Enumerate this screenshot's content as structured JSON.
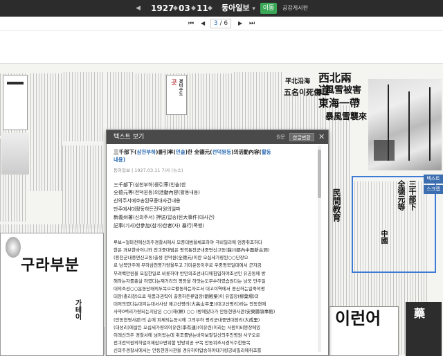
{
  "toolbar": {
    "prev_year": "◀",
    "year": "1927",
    "year_arrow": "◆",
    "month": "03",
    "month_arrow": "◆",
    "day": "11",
    "day_arrow": "◆",
    "publication": "동아일보",
    "publication_arrow": "▾",
    "go_label": "이동",
    "board_label": "공감게시판"
  },
  "pager": {
    "first": "⏮",
    "prev": "◀",
    "current": "3",
    "separator": " / ",
    "total": "6",
    "next": "▶",
    "last": "⏭"
  },
  "side_tabs": [
    "텍스트",
    "스크랩"
  ],
  "modal": {
    "title": "텍스트 보기",
    "tab_original": "원문",
    "tab_hangul": "한글변환",
    "close": "✕",
    "headline_parts": [
      {
        "text": "三千部下(",
        "h": false
      },
      {
        "text": "삼천부하",
        "h": true
      },
      {
        "text": ")를引率(",
        "h": false
      },
      {
        "text": "인솔",
        "h": true
      },
      {
        "text": ")한 全德元(",
        "h": false
      },
      {
        "text": "전덕원등",
        "h": true
      },
      {
        "text": ")의活動內容(",
        "h": false
      },
      {
        "text": "활동",
        "h": true
      }
    ],
    "headline_line2": "내용)",
    "meta": "동아일보 | 1927.03.11 기사 (뉴스)",
    "sublines": [
      "三千部下(삼천부하)를引率(인솔)한",
      "全德元等(전덕원등)의活動內容(활동내용)",
      "신의주서에호송된모중대사건내용",
      "만주에서대활동하든전덕원의일파",
      "新義州署(신의주서) 押送(압송)된大事件(대사건)",
      "記事(기사)한參加(참가)한者(자) 暴行(폭행)"
    ],
    "paragraph": [
      "루보=얼마전에신의주경찰서에서 모중대범을체포하야 극비밀리에 엄중취조하다",
      "한은 과보한바어니와 전긔중대범은 평북통천군내중면신고동(龍川郡內中面新古洞)",
      "(용천군내중면신고동)출생 전덕원(全德元)이란 오십세가량된○○단장으",
      "로 남북만주에 부하삼천명가량을두고 기미운동이후로 우중평북일대에서 군자금",
      "무려백만원을 모집한일로 비롯하야 반민의조선내디에침입하야조선인 유공동에 방",
      "해하는자를총살 하였다는재거리의 평등을 하얏는도무수하였습원다는 남북 만주일",
      "대의조선○○운동단매의두목으로활동하든자로서 대고이역에서 종신허는일죽의평",
      "대장(총리장)으로 위풍과권력이 출중하든류업장(劉殿榮)이 유엽장(柳葉場)의",
      "대저의였다는대지는대서사상 매고산평리(大高山平里)(대고산평리)라는 안동현에",
      "사약0벽리가량되는지당은 ○○(해(鮮) ○○ )방에있다가 안동현영사관(安東縣領事館)",
      "(안동현영사관)의 손에 피체되는동시에 그의부하 평리군내중면대정리(大成里)",
      "(대성리)에살든 오십세가량의이유련(李有連)(이유련)이라는 사람이비봉장에있",
      "이래신의주 경찰서에 넘어왔는데 취조를받는바자보잘길신의주민병원 사구오로",
      "전긔전덕원의하얼이제잡으면위함 안망위공 구목 안동위조시경식주한등목",
      "신의주경찰서에서는 안동현영사관을 경유하야압송하야대가량공비밀리에취조를"
    ]
  },
  "paper_text": {
    "headline_right_1": "西北兩道",
    "headline_right_2": "風雪被害",
    "headline_right_3": "東海一帶",
    "headline_right_4": "暴風雪襲來",
    "headline_mid_1": "平北沿海",
    "headline_mid_2": "五名이死傷",
    "ad_top_1": "곳",
    "ad_top_2": "경비수도",
    "ad_left_vertical": "구라부분",
    "ad_left_sub": "가테이",
    "ad_bottom": "이런어",
    "ad_bottom_right": "藥",
    "paper_mid_1": "民間教育",
    "paper_mid_2": "中國"
  }
}
